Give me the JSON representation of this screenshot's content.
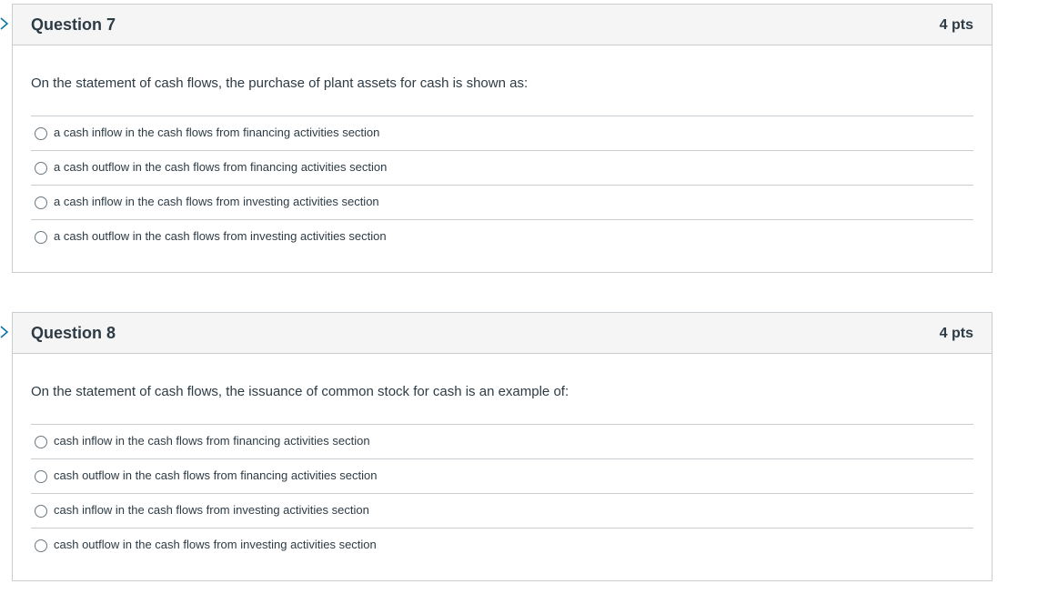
{
  "questions": [
    {
      "title": "Question 7",
      "points": "4 pts",
      "text": "On the statement of cash flows, the purchase of plant assets for cash is shown as:",
      "answers": [
        "a cash inflow in the cash flows from financing activities section",
        "a cash outflow in the cash flows from financing activities section",
        "a cash inflow in the cash flows from investing activities section",
        "a cash outflow in the cash flows from investing activities section"
      ]
    },
    {
      "title": "Question 8",
      "points": "4 pts",
      "text": "On the statement of cash flows, the issuance of common stock for cash is an example of:",
      "answers": [
        "cash inflow in the cash flows from financing activities section",
        "cash outflow in the cash flows from financing activities section",
        "cash inflow in the cash flows from investing activities section",
        "cash outflow in the cash flows from investing activities section"
      ]
    }
  ],
  "colors": {
    "header_bg": "#f5f5f5",
    "border": "#c7cdd1",
    "text": "#2d3b45",
    "flag": "#0770a3"
  },
  "icons": {
    "flag": "flag-question-icon",
    "radio": "radio-button-icon"
  }
}
